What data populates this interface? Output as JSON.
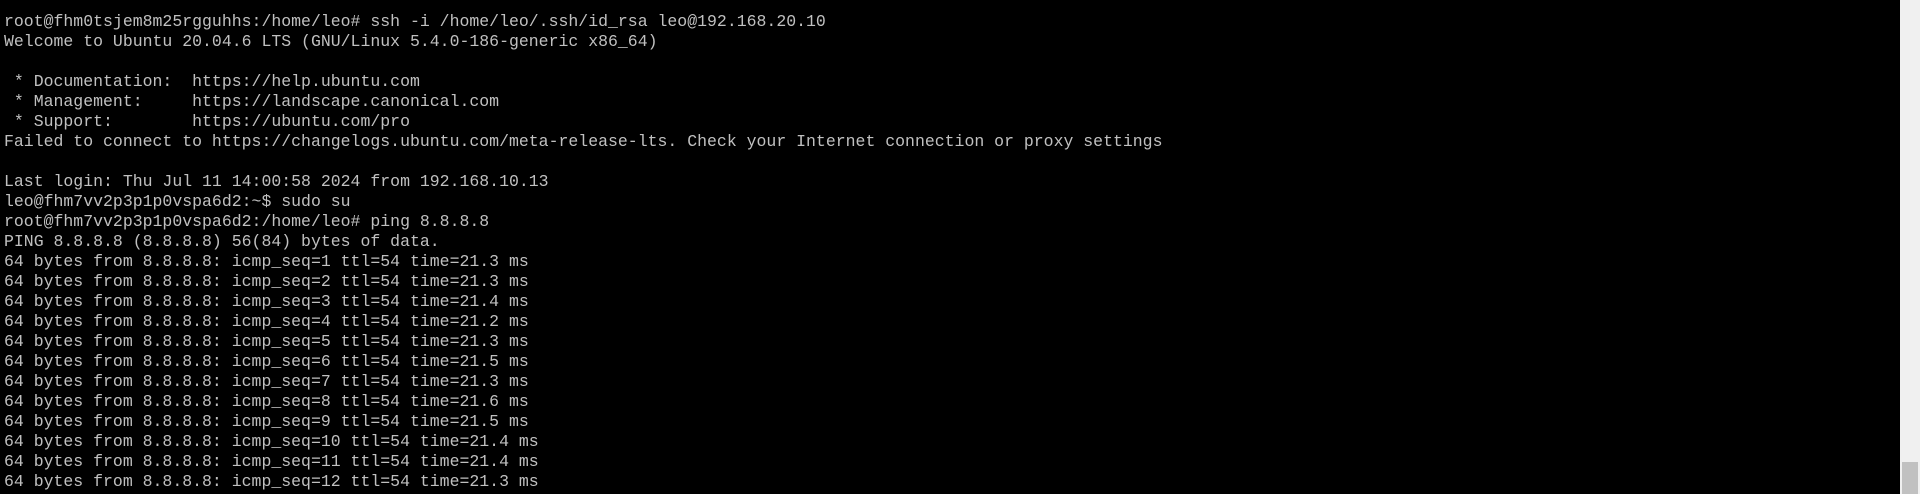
{
  "terminal": {
    "lines": [
      "root@fhm0tsjem8m25rgguhhs:/home/leo# ssh -i /home/leo/.ssh/id_rsa leo@192.168.20.10",
      "Welcome to Ubuntu 20.04.6 LTS (GNU/Linux 5.4.0-186-generic x86_64)",
      "",
      " * Documentation:  https://help.ubuntu.com",
      " * Management:     https://landscape.canonical.com",
      " * Support:        https://ubuntu.com/pro",
      "Failed to connect to https://changelogs.ubuntu.com/meta-release-lts. Check your Internet connection or proxy settings",
      "",
      "Last login: Thu Jul 11 14:00:58 2024 from 192.168.10.13",
      "leo@fhm7vv2p3p1p0vspa6d2:~$ sudo su",
      "root@fhm7vv2p3p1p0vspa6d2:/home/leo# ping 8.8.8.8",
      "PING 8.8.8.8 (8.8.8.8) 56(84) bytes of data.",
      "64 bytes from 8.8.8.8: icmp_seq=1 ttl=54 time=21.3 ms",
      "64 bytes from 8.8.8.8: icmp_seq=2 ttl=54 time=21.3 ms",
      "64 bytes from 8.8.8.8: icmp_seq=3 ttl=54 time=21.4 ms",
      "64 bytes from 8.8.8.8: icmp_seq=4 ttl=54 time=21.2 ms",
      "64 bytes from 8.8.8.8: icmp_seq=5 ttl=54 time=21.3 ms",
      "64 bytes from 8.8.8.8: icmp_seq=6 ttl=54 time=21.5 ms",
      "64 bytes from 8.8.8.8: icmp_seq=7 ttl=54 time=21.3 ms",
      "64 bytes from 8.8.8.8: icmp_seq=8 ttl=54 time=21.6 ms",
      "64 bytes from 8.8.8.8: icmp_seq=9 ttl=54 time=21.5 ms",
      "64 bytes from 8.8.8.8: icmp_seq=10 ttl=54 time=21.4 ms",
      "64 bytes from 8.8.8.8: icmp_seq=11 ttl=54 time=21.4 ms",
      "64 bytes from 8.8.8.8: icmp_seq=12 ttl=54 time=21.3 ms"
    ],
    "colors": {
      "background": "#000000",
      "foreground": "#c0c0c0",
      "scrollbar_track": "#f0f0f0",
      "scrollbar_thumb": "#c1c1c1"
    }
  }
}
